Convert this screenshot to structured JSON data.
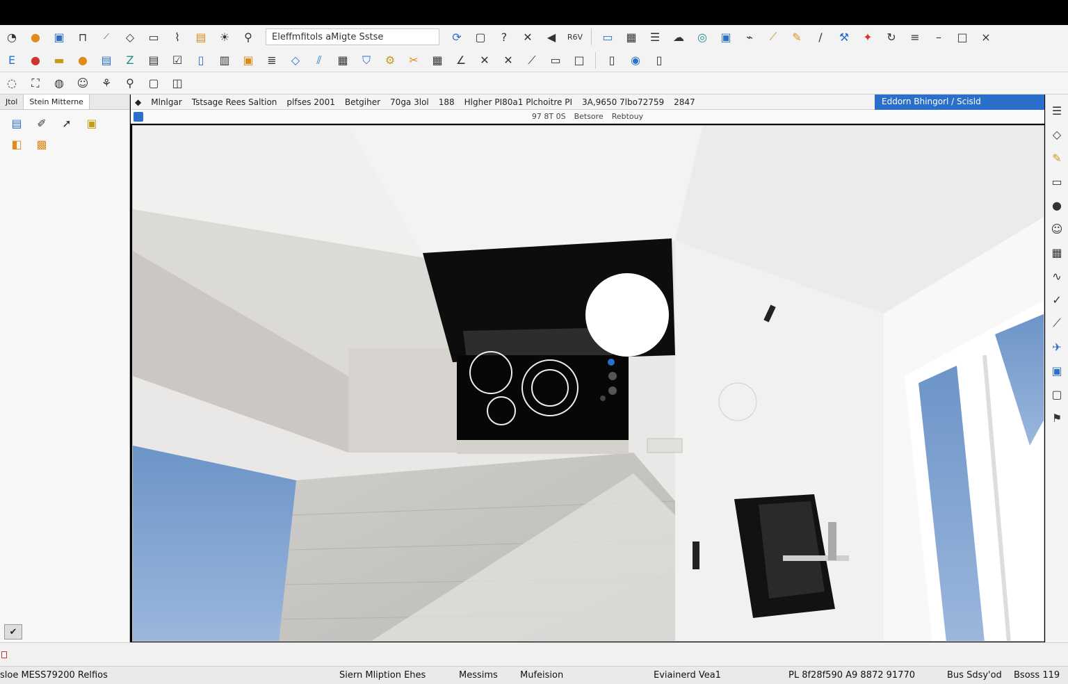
{
  "toolbar1": {
    "search_text": "Eleffmfitols aMigte Sstse",
    "label_rev": "R6V"
  },
  "left_panel": {
    "tabs": [
      "Jtol",
      "Stein Mitterne"
    ]
  },
  "info_bar": {
    "items": [
      "Mlnlgar",
      "Tstsage Rees Saltion",
      "plfses 2001",
      "Betgiher",
      "70ga 3lol",
      "188",
      "Hlgher PI80a1 Plchoitre PI",
      "3A,9650 7lbo72759",
      "2847"
    ],
    "highlight": "Eddorn  Bhingorl / Scisld"
  },
  "sub_bar": {
    "items": [
      "97 8T 0S",
      "Betsore",
      "Rebtouy"
    ]
  },
  "status_bar": {
    "left": "sloe MESS79200 Relfios",
    "item1": "Siern Mliption Ehes",
    "item2": "Messims",
    "item3": "Mufeision",
    "item4": "Eviainerd Vea1",
    "item5": "PL 8f28f590  A9 8872 91770",
    "item6": "Bus Sdsy'od",
    "item7": "Bsoss 119"
  }
}
